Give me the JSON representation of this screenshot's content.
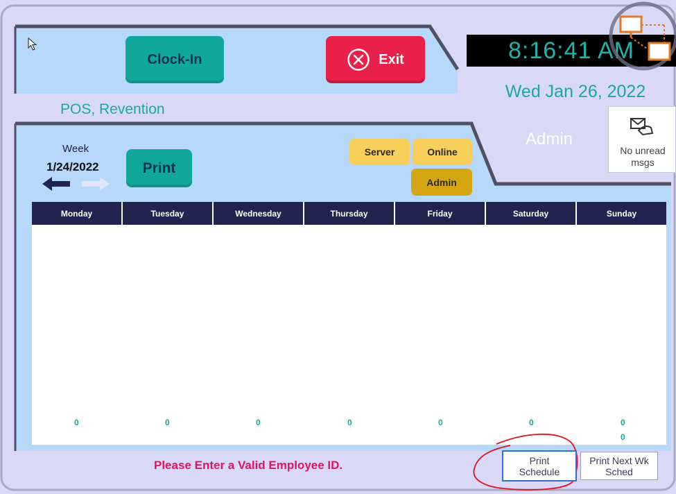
{
  "header": {
    "clock_in_label": "Clock-In",
    "exit_label": "Exit",
    "time": "8:16:41 AM",
    "date": "Wed Jan 26, 2022",
    "location": "POS, Revention",
    "user_role": "Admin",
    "messages_label": "No unread msgs"
  },
  "week": {
    "caption": "Week",
    "date": "1/24/2022",
    "print_label": "Print"
  },
  "filters": [
    {
      "label": "Server",
      "color": "#f7cf5a"
    },
    {
      "label": "Online",
      "color": "#f7cf5a"
    },
    {
      "label": "Admin",
      "color": "#d4a612"
    }
  ],
  "schedule": {
    "days": [
      "Monday",
      "Tuesday",
      "Wednesday",
      "Thursday",
      "Friday",
      "Saturday",
      "Sunday"
    ],
    "counts": [
      "0",
      "0",
      "0",
      "0",
      "0",
      "0",
      "0"
    ],
    "sunday_extra_count": "0"
  },
  "footer": {
    "status_message": "Please Enter a Valid Employee ID.",
    "print_schedule_label": "Print Schedule",
    "print_next_week_label": "Print Next Wk Sched"
  },
  "colors": {
    "panel": "#b6d8fa",
    "background": "#d9d8f7",
    "accent_teal": "#10a89d",
    "exit_red": "#e8204a",
    "header_navy": "#23234f",
    "status_pink": "#e0155f",
    "annotation_red": "#e4101a"
  },
  "icons": [
    "cursor-arrow-icon",
    "exit-circle-x-icon",
    "network-computers-icon",
    "hand-envelope-icon",
    "arrow-left-icon",
    "arrow-right-icon"
  ]
}
